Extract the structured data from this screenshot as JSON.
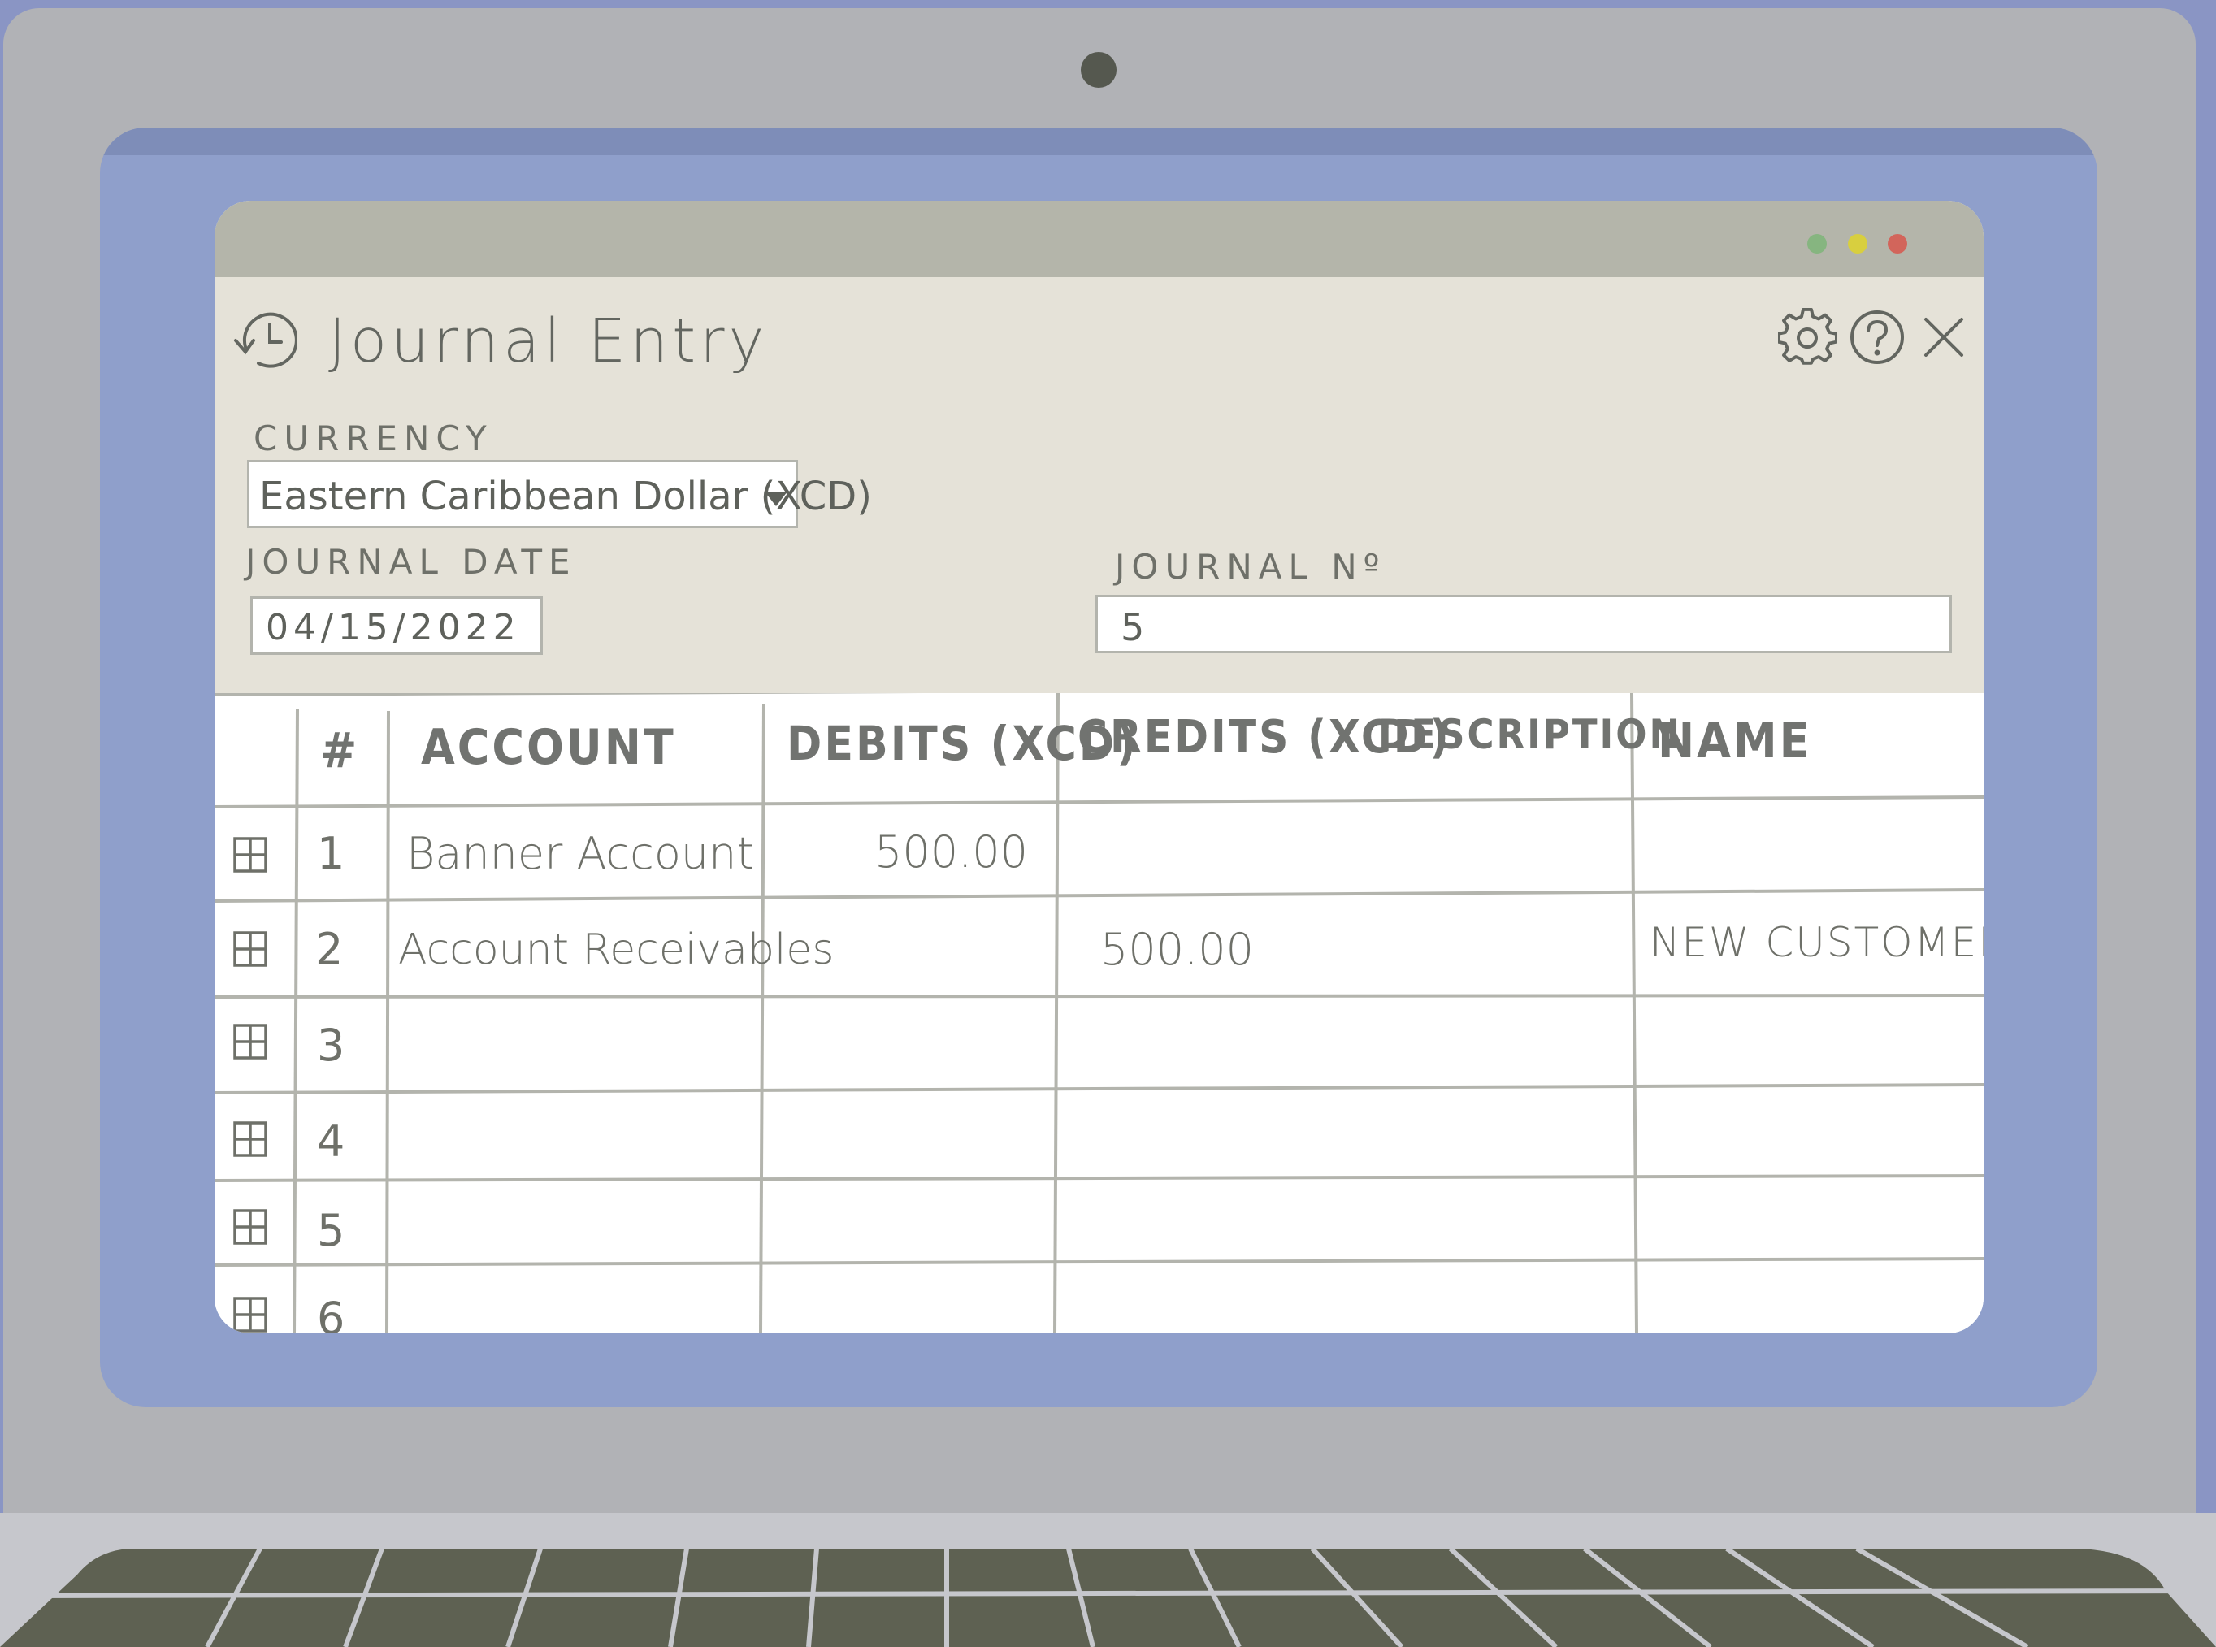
{
  "app": {
    "title": "Journal Entry"
  },
  "form": {
    "currency_label": "CURRENCY",
    "currency_value": "Eastern Caribbean Dollar (XCD)",
    "journal_date_label": "JOURNAL DATE",
    "journal_date_value": "04/15/2022",
    "journal_no_label": "JOURNAL Nº",
    "journal_no_value": "5"
  },
  "table": {
    "columns": [
      "#",
      "ACCOUNT",
      "DEBITS (XCD)",
      "CREDITS (XCD)",
      "DESCRIPTION",
      "NAME"
    ],
    "rows": [
      {
        "num": "1",
        "account": "Banner Account",
        "debit": "500.00",
        "credit": "",
        "description": "",
        "name": ""
      },
      {
        "num": "2",
        "account": "Account Receivables",
        "debit": "",
        "credit": "500.00",
        "description": "",
        "name": "NEW CUSTOMER"
      },
      {
        "num": "3",
        "account": "",
        "debit": "",
        "credit": "",
        "description": "",
        "name": ""
      },
      {
        "num": "4",
        "account": "",
        "debit": "",
        "credit": "",
        "description": "",
        "name": ""
      },
      {
        "num": "5",
        "account": "",
        "debit": "",
        "credit": "",
        "description": "",
        "name": ""
      },
      {
        "num": "6",
        "account": "",
        "debit": "",
        "credit": "",
        "description": "",
        "name": ""
      }
    ]
  },
  "icons": {
    "history": "history-icon",
    "settings": "gear-icon",
    "help": "help-icon",
    "close": "close-icon",
    "row_handle": "grid-icon"
  },
  "colors": {
    "page_bg": "#8a95c4",
    "laptop": "#b1b2b6",
    "bezel": "#8f9fcb",
    "titlebar": "#b4b5aa",
    "header_panel": "#e5e2d8",
    "traffic_green": "#86b580",
    "traffic_yellow": "#d8cf3f",
    "traffic_red": "#d2655b"
  }
}
